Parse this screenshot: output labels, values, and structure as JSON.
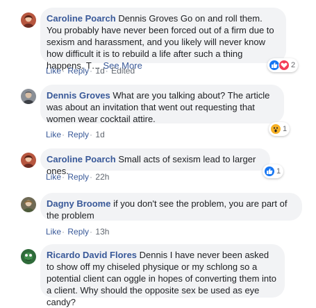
{
  "comments": [
    {
      "author": "Caroline Poarch",
      "text": "Dennis Groves Go on and roll them. You probably have never been forced out of a firm due to sexism and harassment, and you likely will never know how difficult it is to rebuild a life after such a thing happens. T…",
      "see_more": "See More",
      "actions": {
        "like": "Like",
        "reply": "Reply",
        "time": "1d",
        "edited": "Edited"
      },
      "reactions": {
        "icons": [
          "like-icon",
          "love-icon"
        ],
        "count": "2"
      }
    },
    {
      "author": "Dennis Groves",
      "text": "What are you talking about? The article was about an invitation that went out requesting that women wear cocktail attire.",
      "actions": {
        "like": "Like",
        "reply": "Reply",
        "time": "1d"
      },
      "reactions": {
        "icons": [
          "wow-icon"
        ],
        "count": "1"
      }
    },
    {
      "author": "Caroline Poarch",
      "text": "Small acts of sexism lead to larger ones.",
      "actions": {
        "like": "Like",
        "reply": "Reply",
        "time": "22h"
      },
      "reactions": {
        "icons": [
          "like-icon"
        ],
        "count": "1"
      }
    },
    {
      "author": "Dagny Broome",
      "text": "if you don't see the problem, you are part of the problem",
      "actions": {
        "like": "Like",
        "reply": "Reply",
        "time": "13h"
      }
    },
    {
      "author": "Ricardo David Flores",
      "text": "Dennis I have never been asked to show off my chiseled physique or my schlong so a potential client can oggle in hopes of converting them into a client. Why should the opposite sex be used as eye candy?"
    }
  ],
  "colors": {
    "link": "#385898",
    "bubble": "#f2f3f5",
    "meta": "#616770",
    "like": "#1877f2",
    "love": "#f33e58",
    "wow": "#f7b125"
  }
}
